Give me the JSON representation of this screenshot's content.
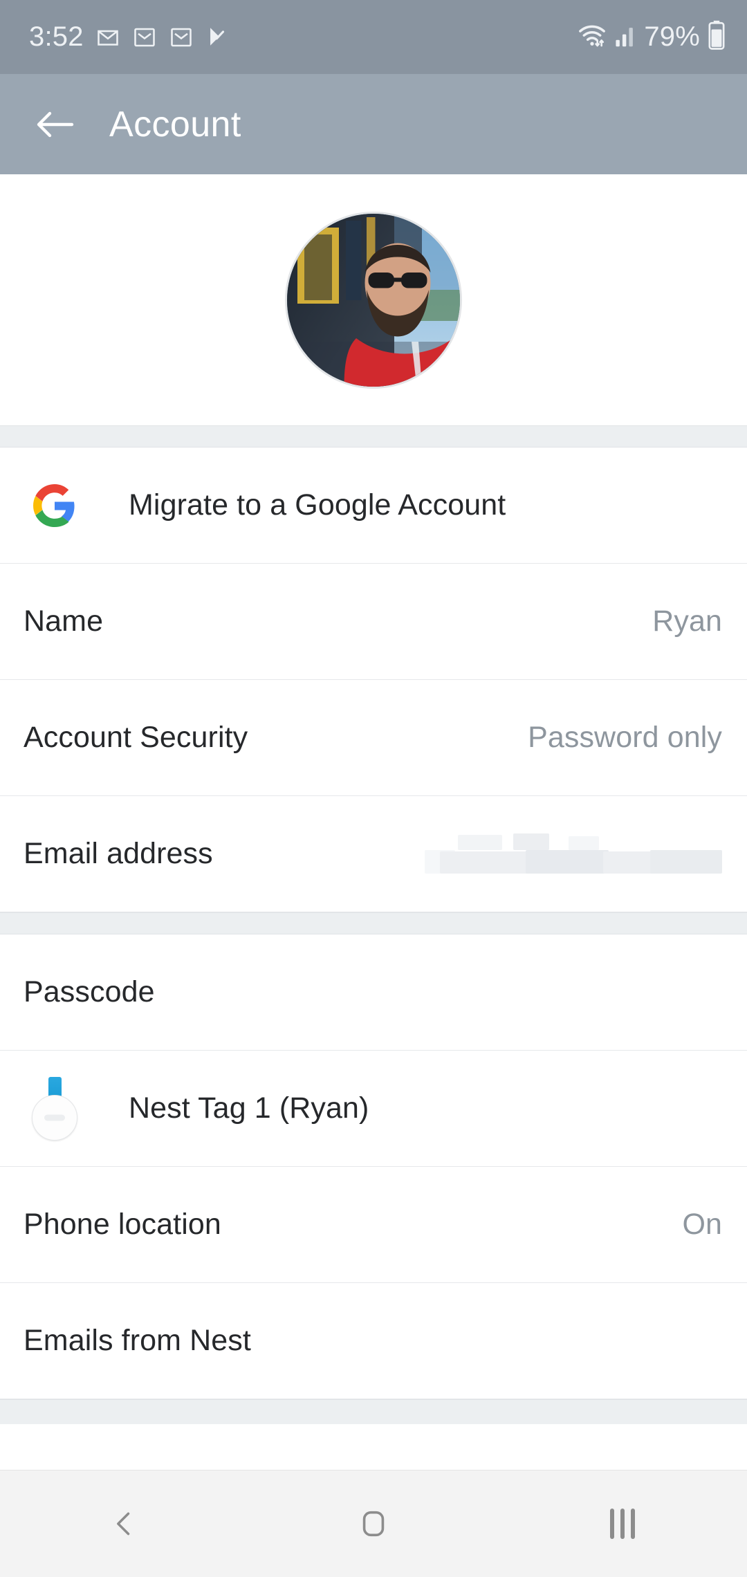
{
  "status_bar": {
    "clock": "3:52",
    "battery_percent": "79%",
    "icons": [
      "gmail-icon",
      "gmail-icon",
      "gmail-icon",
      "tasks-icon",
      "wifi-icon",
      "cellular-signal-icon",
      "battery-icon"
    ],
    "background_color": "#8994a0",
    "foreground_color": "#eef1f4"
  },
  "app_bar": {
    "title": "Account",
    "back_label": "Back",
    "background_color": "#9aa6b2"
  },
  "profile": {
    "avatar_alt": "Profile photo"
  },
  "sections": [
    {
      "rows": [
        {
          "id": "migrate-google",
          "label": "Migrate to a Google Account",
          "value": "",
          "icon": "google-g-icon"
        }
      ]
    },
    {
      "rows": [
        {
          "id": "name",
          "label": "Name",
          "value": "Ryan",
          "icon": ""
        },
        {
          "id": "account-security",
          "label": "Account Security",
          "value": "Password only",
          "icon": ""
        },
        {
          "id": "email-address",
          "label": "Email address",
          "value": "",
          "icon": "",
          "redacted": true
        }
      ]
    },
    {
      "rows": [
        {
          "id": "passcode",
          "label": "Passcode",
          "value": "",
          "icon": ""
        },
        {
          "id": "nest-tag-1",
          "label": "Nest Tag 1 (Ryan)",
          "value": "",
          "icon": "nest-tag-icon"
        },
        {
          "id": "phone-location",
          "label": "Phone location",
          "value": "On",
          "icon": ""
        },
        {
          "id": "emails-from-nest",
          "label": "Emails from Nest",
          "value": "",
          "icon": ""
        }
      ]
    }
  ],
  "nav_bar": {
    "back": "Back",
    "home": "Home",
    "recents": "Recent apps"
  },
  "colors": {
    "label_text": "#26282b",
    "value_text": "#8e969e",
    "divider": "#e6e8ea",
    "section_gap": "#eceff1",
    "google_blue": "#4285F4",
    "google_red": "#EA4335",
    "google_yellow": "#FBBC05",
    "google_green": "#34A853",
    "nest_tag_blue": "#1f9ed6"
  }
}
